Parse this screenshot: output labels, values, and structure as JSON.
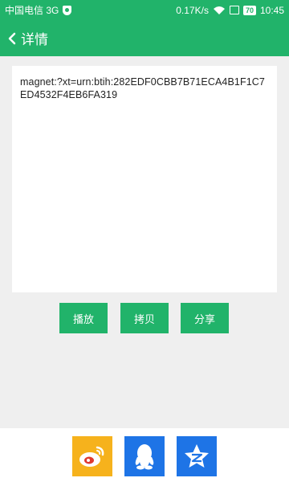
{
  "status": {
    "carrier": "中国电信 3G",
    "speed": "0.17K/s",
    "battery": "70",
    "time": "10:45"
  },
  "header": {
    "title": "详情",
    "back_icon": "chevron-left-icon"
  },
  "content": {
    "magnet": "magnet:?xt=urn:btih:282EDF0CBB7B71ECA4B1F1C7ED4532F4EB6FA319"
  },
  "actions": {
    "play_label": "播放",
    "copy_label": "拷贝",
    "share_label": "分享"
  },
  "share": {
    "items": [
      {
        "name": "weibo",
        "icon": "weibo-icon",
        "color": "#f6b21c"
      },
      {
        "name": "qq",
        "icon": "qq-icon",
        "color": "#1e74e6"
      },
      {
        "name": "qzone",
        "icon": "qzone-icon",
        "color": "#1e74e6"
      }
    ]
  },
  "colors": {
    "accent": "#21b36a",
    "background": "#efefef"
  }
}
